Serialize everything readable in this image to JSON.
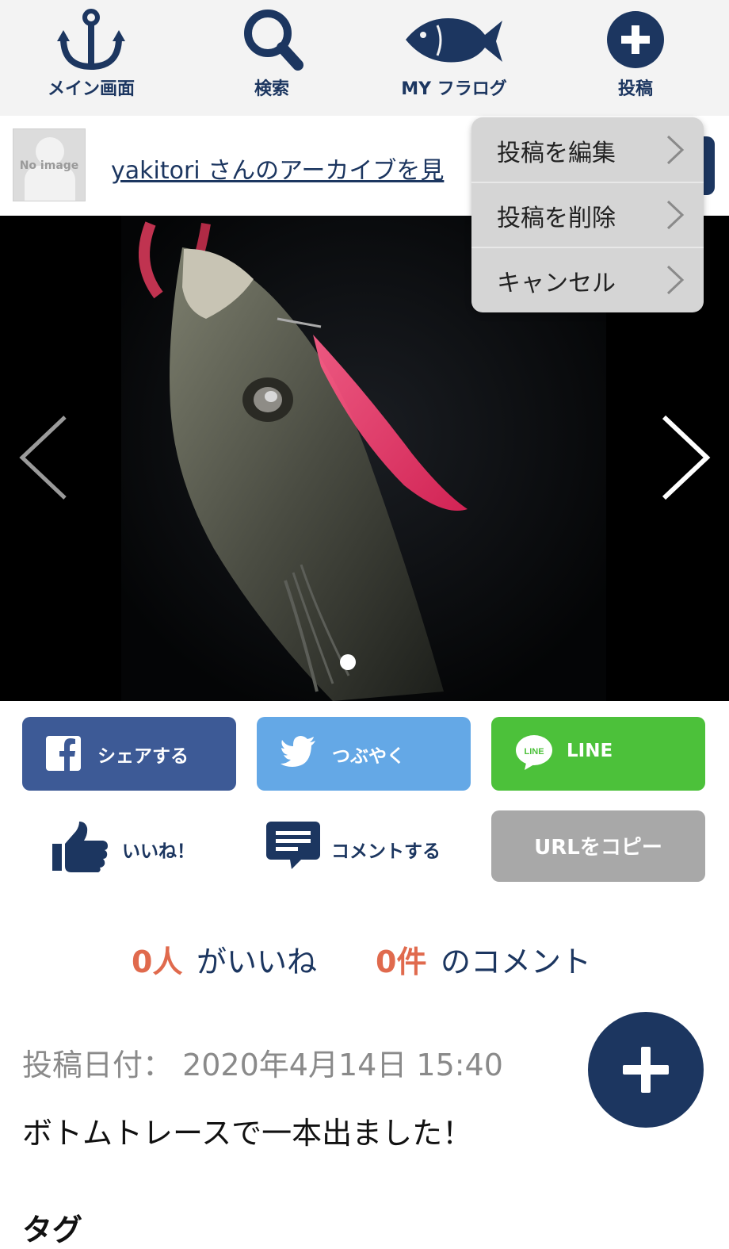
{
  "nav": {
    "items": [
      {
        "label": "メイン画面",
        "icon": "anchor-icon"
      },
      {
        "label": "検索",
        "icon": "search-icon"
      },
      {
        "label": "MY フラログ",
        "icon": "fish-icon"
      },
      {
        "label": "投稿",
        "icon": "plus-circle-icon"
      }
    ]
  },
  "user": {
    "avatar_text": "No image",
    "archive_link": "yakitori さんのアーカイブを見"
  },
  "menu": {
    "items": [
      {
        "label": "投稿を編集"
      },
      {
        "label": "投稿を削除"
      },
      {
        "label": "キャンセル"
      }
    ]
  },
  "photo": {
    "page_indicator": "1 of 1"
  },
  "share": {
    "facebook": "シェアする",
    "twitter": "つぶやく",
    "line": "LINE",
    "line_badge": "LINE"
  },
  "actions": {
    "like": "いいね！",
    "comment": "コメントする",
    "copy_url": "URLをコピー"
  },
  "stats": {
    "likes_count": "0人",
    "likes_text": "がいいね",
    "comments_count": "0件",
    "comments_text": "のコメント"
  },
  "post": {
    "date": "投稿日付： 2020年4月14日 15:40",
    "body": "ボトムトレースで一本出ました！",
    "tags_heading": "タグ"
  },
  "colors": {
    "brand_navy": "#1c3660",
    "facebook": "#3d5a96",
    "twitter": "#64a8e6",
    "line": "#4cc13a",
    "count_accent": "#e06a4d"
  }
}
